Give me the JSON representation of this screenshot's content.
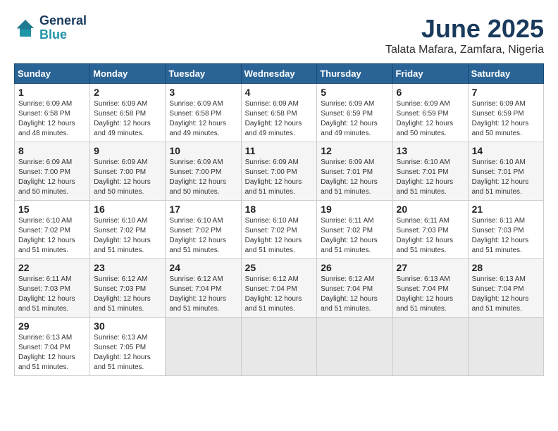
{
  "logo": {
    "line1": "General",
    "line2": "Blue"
  },
  "title": "June 2025",
  "location": "Talata Mafara, Zamfara, Nigeria",
  "weekdays": [
    "Sunday",
    "Monday",
    "Tuesday",
    "Wednesday",
    "Thursday",
    "Friday",
    "Saturday"
  ],
  "weeks": [
    [
      {
        "day": 1,
        "rise": "6:09 AM",
        "set": "6:58 PM",
        "daylight": "12 hours and 48 minutes."
      },
      {
        "day": 2,
        "rise": "6:09 AM",
        "set": "6:58 PM",
        "daylight": "12 hours and 49 minutes."
      },
      {
        "day": 3,
        "rise": "6:09 AM",
        "set": "6:58 PM",
        "daylight": "12 hours and 49 minutes."
      },
      {
        "day": 4,
        "rise": "6:09 AM",
        "set": "6:58 PM",
        "daylight": "12 hours and 49 minutes."
      },
      {
        "day": 5,
        "rise": "6:09 AM",
        "set": "6:59 PM",
        "daylight": "12 hours and 49 minutes."
      },
      {
        "day": 6,
        "rise": "6:09 AM",
        "set": "6:59 PM",
        "daylight": "12 hours and 50 minutes."
      },
      {
        "day": 7,
        "rise": "6:09 AM",
        "set": "6:59 PM",
        "daylight": "12 hours and 50 minutes."
      }
    ],
    [
      {
        "day": 8,
        "rise": "6:09 AM",
        "set": "7:00 PM",
        "daylight": "12 hours and 50 minutes."
      },
      {
        "day": 9,
        "rise": "6:09 AM",
        "set": "7:00 PM",
        "daylight": "12 hours and 50 minutes."
      },
      {
        "day": 10,
        "rise": "6:09 AM",
        "set": "7:00 PM",
        "daylight": "12 hours and 50 minutes."
      },
      {
        "day": 11,
        "rise": "6:09 AM",
        "set": "7:00 PM",
        "daylight": "12 hours and 51 minutes."
      },
      {
        "day": 12,
        "rise": "6:09 AM",
        "set": "7:01 PM",
        "daylight": "12 hours and 51 minutes."
      },
      {
        "day": 13,
        "rise": "6:10 AM",
        "set": "7:01 PM",
        "daylight": "12 hours and 51 minutes."
      },
      {
        "day": 14,
        "rise": "6:10 AM",
        "set": "7:01 PM",
        "daylight": "12 hours and 51 minutes."
      }
    ],
    [
      {
        "day": 15,
        "rise": "6:10 AM",
        "set": "7:02 PM",
        "daylight": "12 hours and 51 minutes."
      },
      {
        "day": 16,
        "rise": "6:10 AM",
        "set": "7:02 PM",
        "daylight": "12 hours and 51 minutes."
      },
      {
        "day": 17,
        "rise": "6:10 AM",
        "set": "7:02 PM",
        "daylight": "12 hours and 51 minutes."
      },
      {
        "day": 18,
        "rise": "6:10 AM",
        "set": "7:02 PM",
        "daylight": "12 hours and 51 minutes."
      },
      {
        "day": 19,
        "rise": "6:11 AM",
        "set": "7:02 PM",
        "daylight": "12 hours and 51 minutes."
      },
      {
        "day": 20,
        "rise": "6:11 AM",
        "set": "7:03 PM",
        "daylight": "12 hours and 51 minutes."
      },
      {
        "day": 21,
        "rise": "6:11 AM",
        "set": "7:03 PM",
        "daylight": "12 hours and 51 minutes."
      }
    ],
    [
      {
        "day": 22,
        "rise": "6:11 AM",
        "set": "7:03 PM",
        "daylight": "12 hours and 51 minutes."
      },
      {
        "day": 23,
        "rise": "6:12 AM",
        "set": "7:03 PM",
        "daylight": "12 hours and 51 minutes."
      },
      {
        "day": 24,
        "rise": "6:12 AM",
        "set": "7:04 PM",
        "daylight": "12 hours and 51 minutes."
      },
      {
        "day": 25,
        "rise": "6:12 AM",
        "set": "7:04 PM",
        "daylight": "12 hours and 51 minutes."
      },
      {
        "day": 26,
        "rise": "6:12 AM",
        "set": "7:04 PM",
        "daylight": "12 hours and 51 minutes."
      },
      {
        "day": 27,
        "rise": "6:13 AM",
        "set": "7:04 PM",
        "daylight": "12 hours and 51 minutes."
      },
      {
        "day": 28,
        "rise": "6:13 AM",
        "set": "7:04 PM",
        "daylight": "12 hours and 51 minutes."
      }
    ],
    [
      {
        "day": 29,
        "rise": "6:13 AM",
        "set": "7:04 PM",
        "daylight": "12 hours and 51 minutes."
      },
      {
        "day": 30,
        "rise": "6:13 AM",
        "set": "7:05 PM",
        "daylight": "12 hours and 51 minutes."
      },
      null,
      null,
      null,
      null,
      null
    ]
  ],
  "labels": {
    "sunrise": "Sunrise:",
    "sunset": "Sunset:",
    "daylight": "Daylight: 12 hours"
  }
}
